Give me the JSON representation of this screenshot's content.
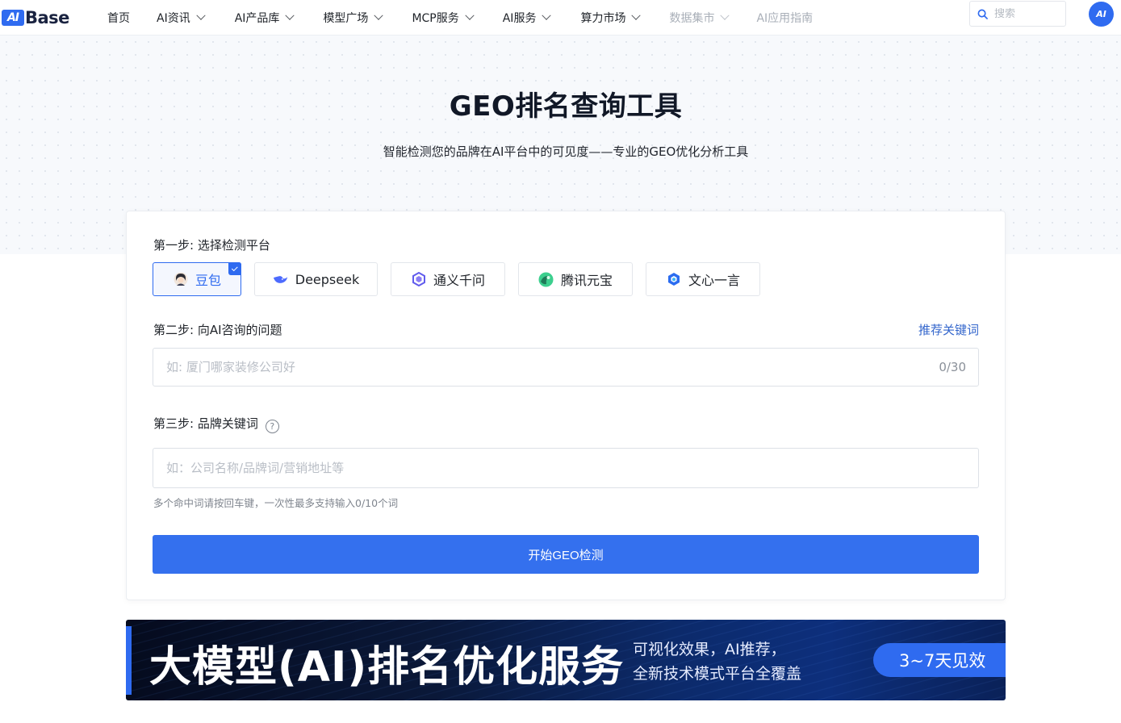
{
  "header": {
    "logo_mark": "AI",
    "logo_text": "Base",
    "nav": [
      {
        "label": "首页",
        "has_dropdown": false,
        "muted": false
      },
      {
        "label": "AI资讯",
        "has_dropdown": true,
        "muted": false
      },
      {
        "label": "AI产品库",
        "has_dropdown": true,
        "muted": false
      },
      {
        "label": "模型广场",
        "has_dropdown": true,
        "muted": false
      },
      {
        "label": "MCP服务",
        "has_dropdown": true,
        "muted": false
      },
      {
        "label": "AI服务",
        "has_dropdown": true,
        "muted": false
      },
      {
        "label": "算力市场",
        "has_dropdown": true,
        "muted": false
      },
      {
        "label": "数据集市",
        "has_dropdown": true,
        "muted": true
      },
      {
        "label": "AI应用指南",
        "has_dropdown": false,
        "muted": true
      }
    ],
    "search_placeholder": "搜索",
    "avatar_text": "AI"
  },
  "hero": {
    "title": "GEO排名查询工具",
    "subtitle": "智能检测您的品牌在AI平台中的可见度——专业的GEO优化分析工具"
  },
  "form": {
    "step1_label": "第一步: 选择检测平台",
    "platforms": [
      {
        "label": "豆包",
        "icon": "doubao-avatar-icon",
        "selected": true
      },
      {
        "label": "Deepseek",
        "icon": "deepseek-whale-icon",
        "selected": false
      },
      {
        "label": "通义千问",
        "icon": "tongyi-icon",
        "selected": false
      },
      {
        "label": "腾讯元宝",
        "icon": "yuanbao-icon",
        "selected": false
      },
      {
        "label": "文心一言",
        "icon": "wenxin-icon",
        "selected": false
      }
    ],
    "step2_label": "第二步: 向AI咨询的问题",
    "recommend_link": "推荐关键词",
    "question_placeholder": "如: 厦门哪家装修公司好",
    "question_counter": "0/30",
    "step3_label": "第三步: 品牌关键词",
    "help_symbol": "?",
    "keyword_placeholder": "如：公司名称/品牌词/营销地址等",
    "keyword_hint": "多个命中词请按回车键，一次性最多支持输入0/10个词",
    "submit_label": "开始GEO检测"
  },
  "banner": {
    "headline": "大模型(AI)排名优化服务",
    "line1": "可视化效果，AI推荐，",
    "line2": "全新技术模式平台全覆盖",
    "pill": "3~7天见效"
  },
  "colors": {
    "accent": "#2f6bf0",
    "button": "#3470ee",
    "link": "#3366cc"
  }
}
